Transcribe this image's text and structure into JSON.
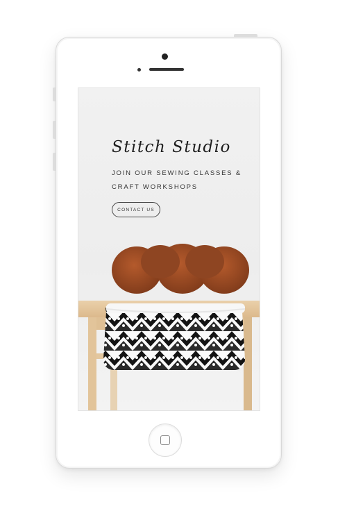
{
  "site": {
    "title": "Stitch Studio",
    "subtitle_lines": [
      "JOIN OUR SEWING CLASSES &",
      "CRAFT WORKSHOPS"
    ],
    "cta_label": "CONTACT US"
  },
  "image": {
    "description_icon": "yarn-basket-photo"
  },
  "colors": {
    "screen_background": "#efefef",
    "yarn": "#9a4a24",
    "stool_wood": "#e7c9a0",
    "basket_dark": "#141414",
    "basket_light": "#fafafa"
  }
}
